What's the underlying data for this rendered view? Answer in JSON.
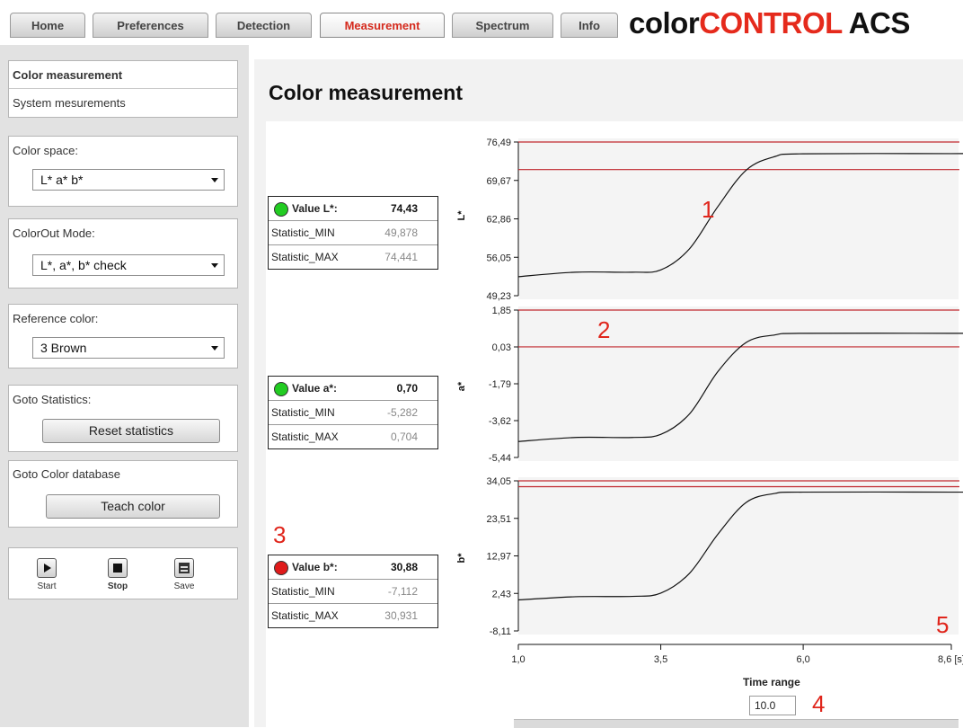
{
  "tabs": [
    {
      "label": "Home",
      "active": false
    },
    {
      "label": "Preferences",
      "active": false
    },
    {
      "label": "Detection",
      "active": false
    },
    {
      "label": "Measurement",
      "active": true
    },
    {
      "label": "Spectrum",
      "active": false
    },
    {
      "label": "Info",
      "active": false
    }
  ],
  "brand": {
    "part1": "color",
    "part2": "CONTROL",
    "part3": " ACS"
  },
  "sidebar": {
    "nav": [
      "Color measurement",
      "System mesurements"
    ],
    "color_space": {
      "label": "Color space:",
      "value": "L* a* b*"
    },
    "colorout": {
      "label": "ColorOut Mode:",
      "value": "L*, a*, b* check"
    },
    "reference": {
      "label": "Reference color:",
      "value": "3 Brown"
    },
    "statistics": {
      "label": "Goto Statistics:",
      "button": "Reset statistics"
    },
    "database": {
      "label": "Goto Color database",
      "button": "Teach color"
    },
    "controls": {
      "start": "Start",
      "stop": "Stop",
      "save": "Save"
    }
  },
  "main": {
    "title": "Color measurement",
    "x_axis_label": "Time range",
    "time_range_value": "10.0"
  },
  "value_tables": [
    {
      "name": "Value L*:",
      "value": "74,43",
      "status_color": "#22cc22",
      "min_label": "Statistic_MIN",
      "min": "49,878",
      "max_label": "Statistic_MAX",
      "max": "74,441"
    },
    {
      "name": "Value a*:",
      "value": "0,70",
      "status_color": "#22cc22",
      "min_label": "Statistic_MIN",
      "min": "-5,282",
      "max_label": "Statistic_MAX",
      "max": "0,704"
    },
    {
      "name": "Value b*:",
      "value": "30,88",
      "status_color": "#e01b1b",
      "min_label": "Statistic_MIN",
      "min": "-7,112",
      "max_label": "Statistic_MAX",
      "max": "30,931"
    }
  ],
  "annotations": [
    "1",
    "2",
    "3",
    "4",
    "5"
  ],
  "chart_data": [
    {
      "type": "line",
      "ylabel": "L*",
      "yticks": [
        "76,49",
        "69,67",
        "62,86",
        "56,05",
        "49,23"
      ],
      "ylim": [
        49.23,
        76.49
      ],
      "limits": [
        76.49,
        71.6
      ],
      "x": [
        1.0,
        2.0,
        3.0,
        3.5,
        4.0,
        4.5,
        5.0,
        5.5,
        6.0,
        8.6
      ],
      "y": [
        52.6,
        53.4,
        53.4,
        53.8,
        57.5,
        65.0,
        71.5,
        73.9,
        74.4,
        74.43
      ]
    },
    {
      "type": "line",
      "ylabel": "a*",
      "yticks": [
        "1,85",
        "0,03",
        "-1,79",
        "-3,62",
        "-5,44"
      ],
      "ylim": [
        -5.44,
        1.85
      ],
      "limits": [
        1.85,
        0.03
      ],
      "x": [
        1.0,
        2.0,
        3.0,
        3.5,
        4.0,
        4.5,
        5.0,
        5.5,
        6.0,
        8.6
      ],
      "y": [
        -4.65,
        -4.45,
        -4.45,
        -4.3,
        -3.3,
        -1.2,
        0.25,
        0.62,
        0.7,
        0.7
      ]
    },
    {
      "type": "line",
      "ylabel": "b*",
      "yticks": [
        "34,05",
        "23,51",
        "12,97",
        "2,43",
        "-8,11"
      ],
      "ylim": [
        -8.11,
        34.05
      ],
      "limits": [
        34.05,
        32.4
      ],
      "x": [
        1.0,
        2.0,
        3.0,
        3.5,
        4.0,
        4.5,
        5.0,
        5.5,
        6.0,
        8.6
      ],
      "y": [
        0.6,
        1.5,
        1.6,
        2.5,
        8.0,
        19.0,
        28.0,
        30.5,
        30.88,
        30.88
      ]
    }
  ],
  "x_ticks": [
    "1,0",
    "3,5",
    "6,0",
    "8,6 [s]"
  ],
  "x_tick_values": [
    1.0,
    3.5,
    6.0,
    8.6
  ],
  "colors": {
    "accent": "#e52a1c",
    "limit_line": "#c0272d",
    "curve": "#111111"
  }
}
